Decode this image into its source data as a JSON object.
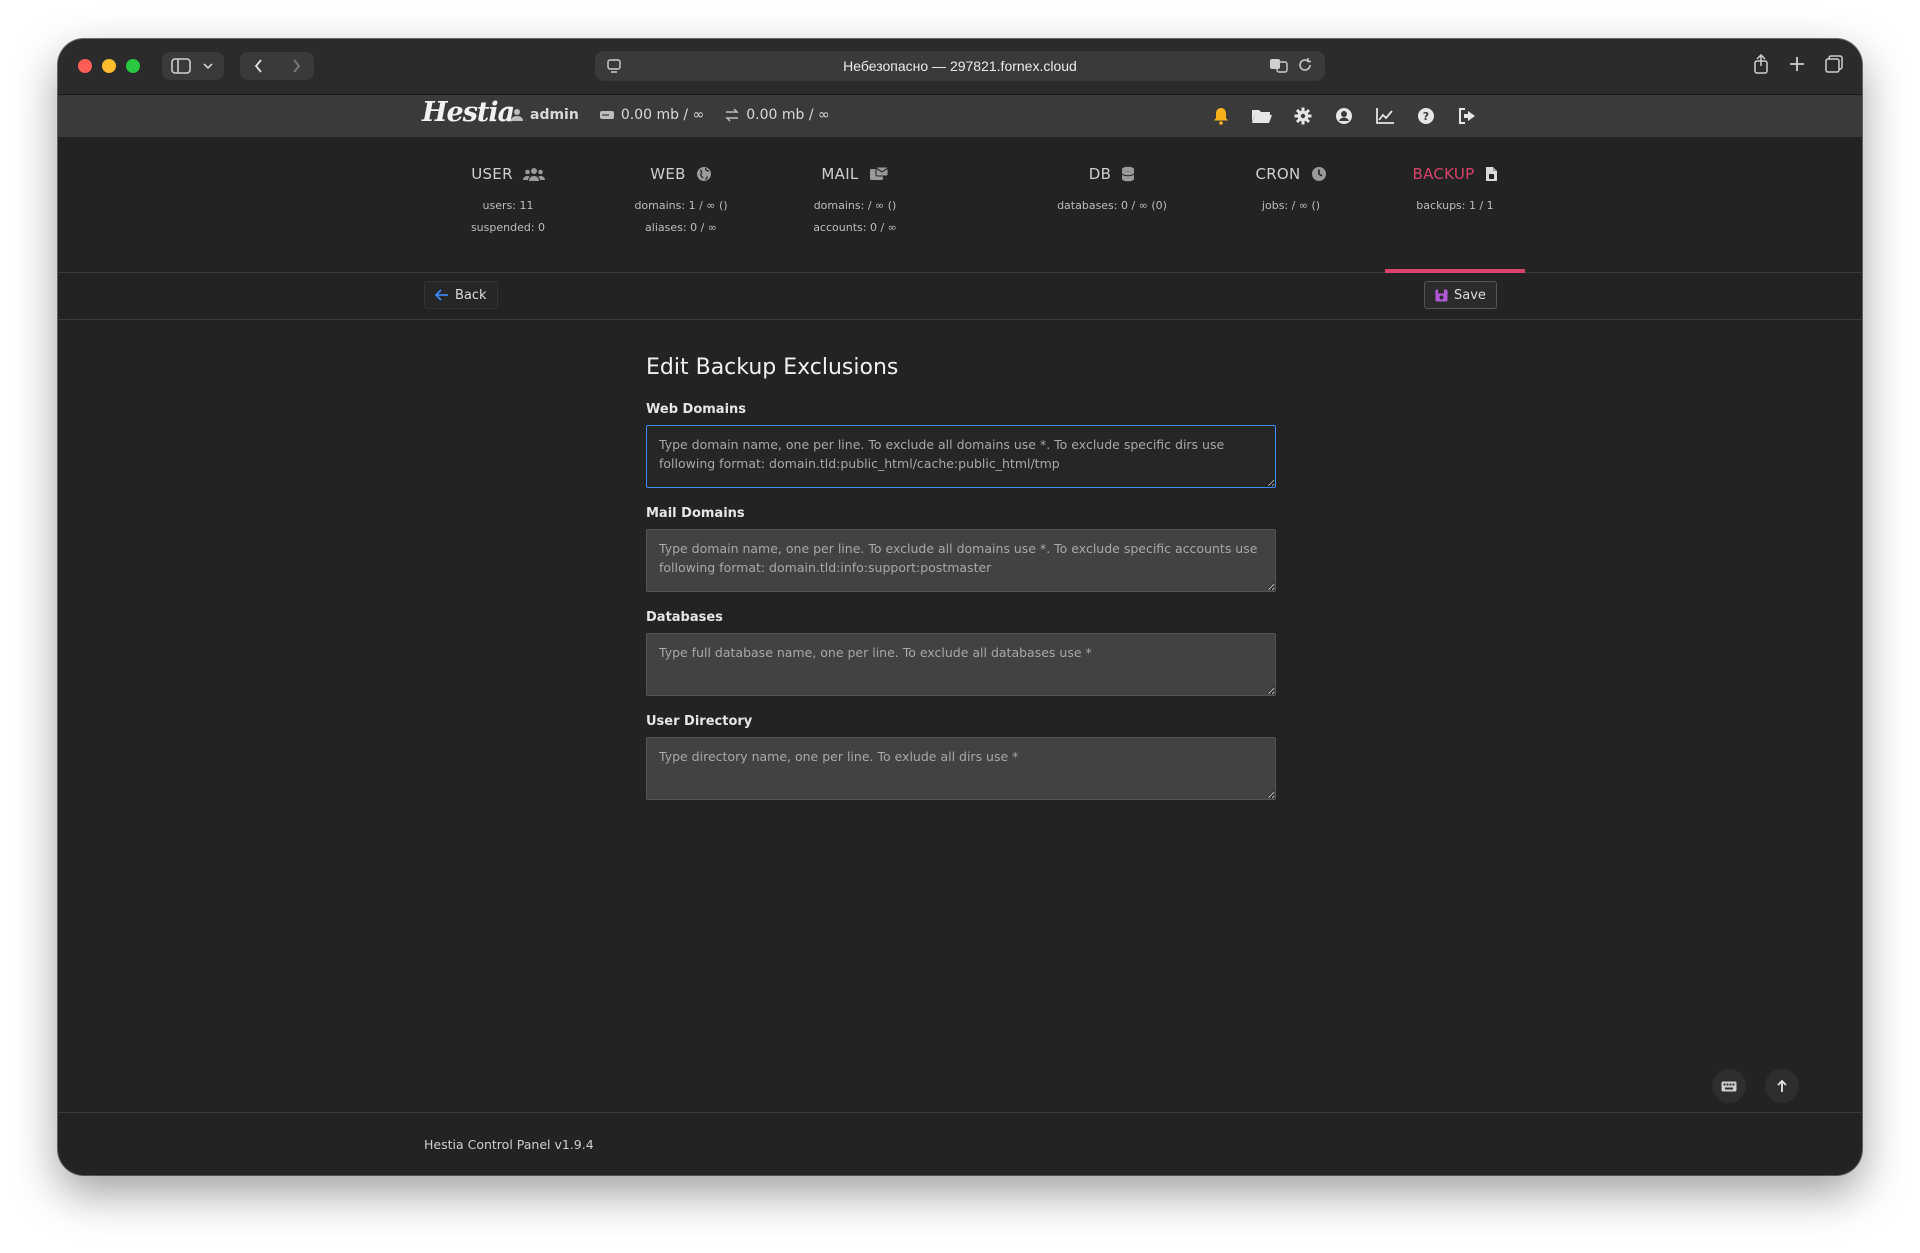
{
  "browser": {
    "address": "Небезопасно — 297821.fornex.cloud"
  },
  "topbar": {
    "logo": "Hestia",
    "username": "admin",
    "disk": "0.00 mb / ∞",
    "bandwidth": "0.00 mb / ∞",
    "icons": [
      "bell-icon",
      "folder-icon",
      "gear-icon",
      "user-circle-icon",
      "chart-icon",
      "help-icon",
      "logout-icon"
    ]
  },
  "tabs": [
    {
      "label": "USER",
      "icon": "users-icon",
      "stats": [
        "users: 11",
        "suspended: 0"
      ]
    },
    {
      "label": "WEB",
      "icon": "globe-icon",
      "stats": [
        "domains: 1 / ∞ ()",
        "aliases: 0 / ∞"
      ]
    },
    {
      "label": "MAIL",
      "icon": "mail-icon",
      "stats": [
        "domains: / ∞ ()",
        "accounts: 0 / ∞"
      ]
    },
    {
      "label": "DB",
      "icon": "database-icon",
      "stats": [
        "databases: 0 / ∞ (0)"
      ]
    },
    {
      "label": "CRON",
      "icon": "clock-icon",
      "stats": [
        "jobs: / ∞ ()"
      ]
    },
    {
      "label": "BACKUP",
      "icon": "file-icon",
      "stats": [
        "backups: 1 / 1"
      ],
      "active": true
    }
  ],
  "toolbar": {
    "back_label": "Back",
    "save_label": "Save"
  },
  "form": {
    "title": "Edit Backup Exclusions",
    "fields": [
      {
        "label": "Web Domains",
        "placeholder": "Type domain name, one per line. To exclude all domains use *. To exclude specific dirs use following format: domain.tld:public_html/cache:public_html/tmp"
      },
      {
        "label": "Mail Domains",
        "placeholder": "Type domain name, one per line. To exclude all domains use *. To exclude specific accounts use following format: domain.tld:info:support:postmaster"
      },
      {
        "label": "Databases",
        "placeholder": "Type full database name, one per line. To exclude all databases use *"
      },
      {
        "label": "User Directory",
        "placeholder": "Type directory name, one per line. To exlude all dirs use *"
      }
    ]
  },
  "footer": {
    "text": "Hestia Control Panel v1.9.4"
  },
  "colors": {
    "accent": "#d9436a",
    "background": "#232323",
    "topbar": "#3a3a3a",
    "focus": "#3d8bfd"
  }
}
